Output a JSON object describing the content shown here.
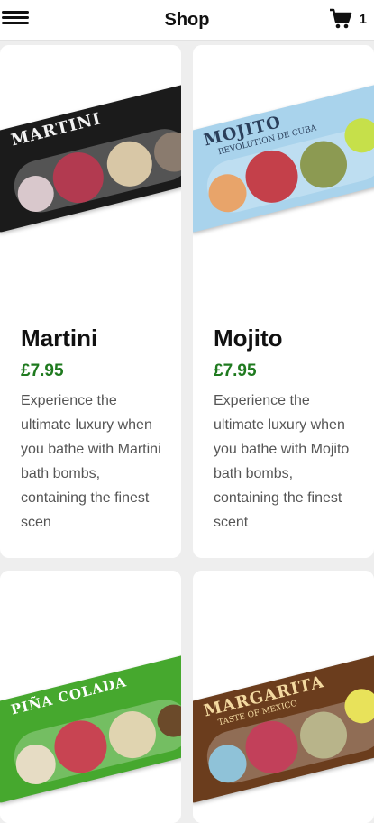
{
  "header": {
    "title": "Shop",
    "menu_icon": "hamburger-menu-icon",
    "cart_icon": "shopping-cart-icon",
    "cart_count": "1"
  },
  "products": [
    {
      "box_text": "MARTINI",
      "box_subtext": "",
      "name": "Martini",
      "price": "£7.95",
      "description": "Experience the ultimate luxury when you bathe with Martini bath bombs, containing the finest scen"
    },
    {
      "box_text": "MOJITO",
      "box_subtext": "REVOLUTION DE CUBA",
      "name": "Mojito",
      "price": "£7.95",
      "description": "Experience the ultimate luxury when you bathe with Mojito bath bombs, containing the finest scent"
    },
    {
      "box_text": "PIÑA COLADA",
      "box_subtext": ""
    },
    {
      "box_text": "MARGARITA",
      "box_subtext": "TASTE OF MEXICO"
    }
  ],
  "colors": {
    "price": "#1f7a1f",
    "martini_box": "#1a1a1a",
    "mojito_box": "#a9d3ec",
    "pina_colada_box": "#46a82e",
    "margarita_box": "#6b3d1d"
  }
}
